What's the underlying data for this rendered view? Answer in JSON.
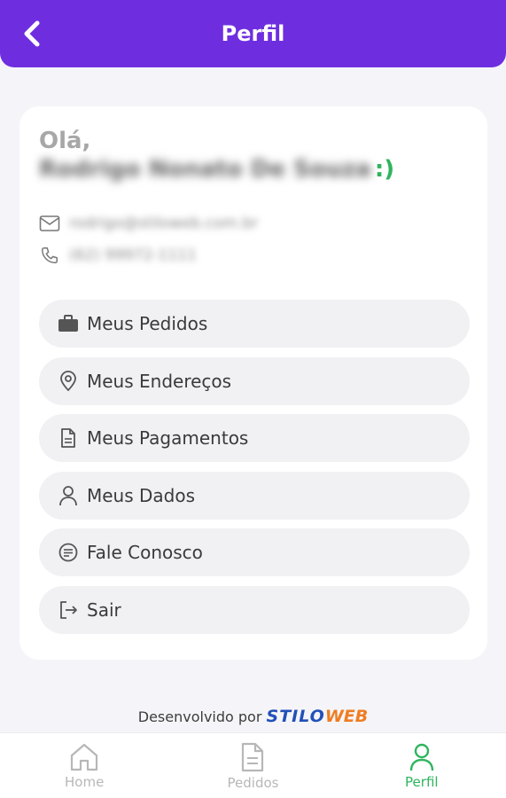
{
  "header": {
    "title": "Perfil",
    "back_icon": "chevron-left-icon"
  },
  "profile": {
    "greeting": "Olá,",
    "name": "Rodrigo Nonato De Souza",
    "smile": ":)",
    "email": "rodrigo@stiloweb.com.br",
    "phone": "(62) 99972-1111"
  },
  "menu": {
    "items": [
      {
        "label": "Meus Pedidos",
        "icon": "briefcase-icon"
      },
      {
        "label": "Meus Endereços",
        "icon": "map-pin-icon"
      },
      {
        "label": "Meus Pagamentos",
        "icon": "document-icon"
      },
      {
        "label": "Meus Dados",
        "icon": "user-icon"
      },
      {
        "label": "Fale Conosco",
        "icon": "chat-icon"
      },
      {
        "label": "Sair",
        "icon": "logout-icon"
      }
    ]
  },
  "footer": {
    "developed_by": "Desenvolvido por",
    "brand_part1": "STILO",
    "brand_part2": "WEB"
  },
  "tabs": [
    {
      "label": "Home",
      "icon": "home-icon",
      "active": false
    },
    {
      "label": "Pedidos",
      "icon": "file-icon",
      "active": false
    },
    {
      "label": "Perfil",
      "icon": "user-icon",
      "active": true
    }
  ],
  "colors": {
    "primary": "#6e2ee0",
    "accent_green": "#2fb45e",
    "brand_blue": "#2250b8",
    "brand_orange": "#ef7d22"
  }
}
